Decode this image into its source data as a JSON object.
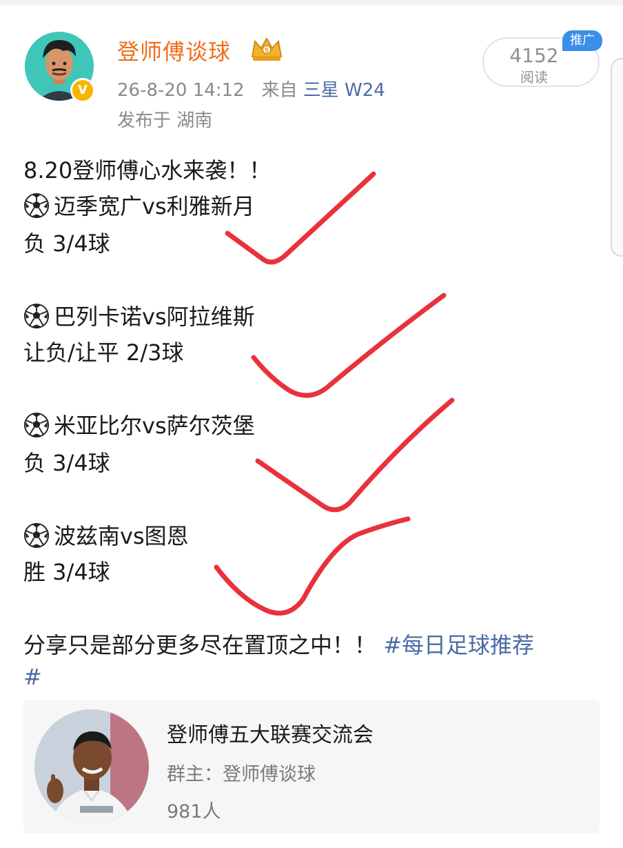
{
  "author": {
    "name": "登师傅谈球",
    "timestamp": "26-8-20 14:12",
    "source_prefix": "来自",
    "device": "三星 W24",
    "location": "发布于 湖南"
  },
  "stats": {
    "read_count": "4152",
    "read_label": "阅读",
    "promo_badge": "推广"
  },
  "post": {
    "title": "8.20登师傅心水来袭！！",
    "matches": [
      {
        "teams": "迈季宽广vs利雅新月",
        "pick": " 负  3/4球"
      },
      {
        "teams": "巴列卡诺vs阿拉维斯",
        "pick": " 让负/让平  2/3球"
      },
      {
        "teams": "米亚比尔vs萨尔茨堡",
        "pick": "负 3/4球"
      },
      {
        "teams": "波兹南vs图恩",
        "pick": "胜 3/4球"
      }
    ],
    "footer_text": "分享只是部分更多尽在置顶之中！！",
    "hashtag_start": "#每日足球推荐",
    "hashtag_end": "#",
    "annotation_color": "#e8323c"
  },
  "group": {
    "title": "登师傅五大联赛交流会",
    "owner": "群主：登师傅谈球",
    "members": "981人"
  },
  "colors": {
    "author_name": "#f06e1b",
    "link": "#4a6ba6",
    "meta_gray": "#8a8a8a",
    "verified": "#f7b500",
    "promo": "#3b8fe8"
  },
  "icons": {
    "verified": "verified-badge-icon",
    "crown": "crown-icon",
    "match": "soccer-ball-icon"
  }
}
